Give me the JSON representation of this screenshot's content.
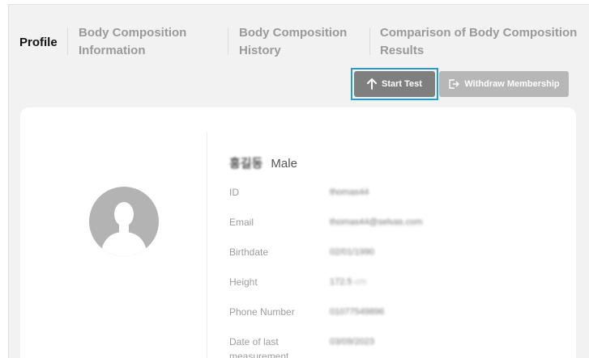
{
  "tabs": [
    {
      "label": "Profile",
      "active": true
    },
    {
      "label": "Body Composition Information",
      "active": false
    },
    {
      "label": "Body Composition History",
      "active": false
    },
    {
      "label": "Comparison of Body Composition Results",
      "active": false
    }
  ],
  "tabs_line2": [
    "Information",
    "History",
    "Results"
  ],
  "tabs_line1": [
    "Body Composition",
    "Body Composition",
    "Comparison of Body Composition"
  ],
  "actions": {
    "start_test": "Start Test",
    "withdraw": "Withdraw Membership"
  },
  "profile": {
    "name": "홍길동",
    "gender": "Male",
    "fields": [
      {
        "label": "ID",
        "value": "thomas44"
      },
      {
        "label": "Email",
        "value": "thomas44@selvas.com"
      },
      {
        "label": "Birthdate",
        "value": "02/01/1990"
      },
      {
        "label": "Height",
        "value": "172.5",
        "unit": "cm"
      },
      {
        "label": "Phone Number",
        "value": "01077549896"
      },
      {
        "label": "Date of last measurement",
        "value": "03/09/2023"
      }
    ],
    "date_label_line1": "Date of last",
    "date_label_line2": "measurement"
  },
  "colors": {
    "highlight": "#1e9fd4",
    "start_button": "#7f7f7f",
    "withdraw_button": "#b7b7b7"
  },
  "icons": {
    "start_test": "arrow-up-icon",
    "withdraw": "exit-icon",
    "avatar": "person-silhouette-icon"
  }
}
